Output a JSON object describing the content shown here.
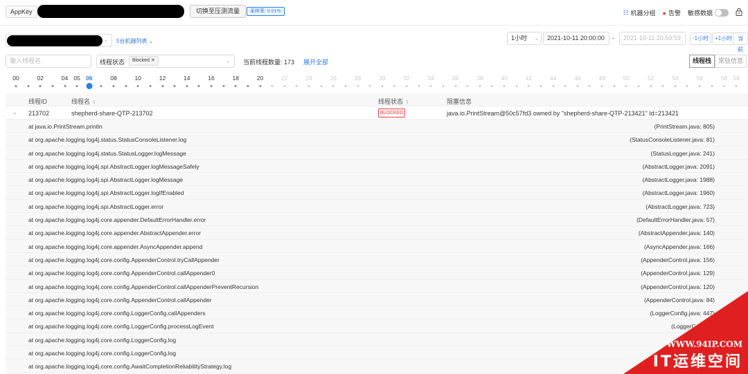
{
  "topbar": {
    "appkey_label": "AppKey",
    "switch_button": "切换至压测流量",
    "sample_rate": "采样率: 0.01%",
    "machine_group": "机器分组",
    "alarm": "告警",
    "sensitive_data": "敏感数据"
  },
  "filters": {
    "machine_list_link": "5台机器列表",
    "range": "1小时",
    "start_time": "2021-10-11 20:00:00",
    "time_separator": "-",
    "end_time": "2021-10-11 20:59:59",
    "step_minus_hour": "-1小时",
    "step_plus_hour": "+1小时",
    "current_btn": "当前"
  },
  "thread_filter": {
    "name_placeholder": "输入线程名",
    "state_label": "线程状态",
    "state_tag": "Blocked",
    "count_text": "当前线程数量: 173",
    "expand_all": "展开全部",
    "tab_stack": "线程栈",
    "tab_resident": "常驻信息"
  },
  "timeline": {
    "current_index": 4,
    "past_count": 11,
    "labels": [
      "00",
      "02",
      "04",
      "05",
      "06",
      "08",
      "10",
      "12",
      "14",
      "16",
      "18",
      "20",
      "22",
      "24",
      "26",
      "28",
      "30",
      "32",
      "34",
      "36",
      "38",
      "40",
      "42",
      "44",
      "46",
      "48",
      "50",
      "52",
      "54",
      "56",
      "58",
      "59"
    ]
  },
  "table": {
    "headers": {
      "thread_id": "线程ID",
      "thread_name": "线程名",
      "thread_state": "线程状态",
      "block_info": "阻塞信息"
    },
    "row": {
      "thread_id": "213702",
      "thread_name": "shepherd-share-QTP-213702",
      "thread_state": "BLOCKED",
      "block_info": "java.io.PrintStream@50c57fd3 owned by \"shepherd-share-QTP-213421\" Id=213421"
    },
    "stack": [
      {
        "method": "at java.io.PrintStream.println",
        "loc": "(PrintStream.java: 805)"
      },
      {
        "method": "at org.apache.logging.log4j.status.StatusConsoleListener.log",
        "loc": "(StatusConsoleListener.java: 81)"
      },
      {
        "method": "at org.apache.logging.log4j.status.StatusLogger.logMessage",
        "loc": "(StatusLogger.java: 241)"
      },
      {
        "method": "at org.apache.logging.log4j.spi.AbstractLogger.logMessageSafely",
        "loc": "(AbstractLogger.java: 2091)"
      },
      {
        "method": "at org.apache.logging.log4j.spi.AbstractLogger.logMessage",
        "loc": "(AbstractLogger.java: 1988)"
      },
      {
        "method": "at org.apache.logging.log4j.spi.AbstractLogger.logIfEnabled",
        "loc": "(AbstractLogger.java: 1960)"
      },
      {
        "method": "at org.apache.logging.log4j.spi.AbstractLogger.error",
        "loc": "(AbstractLogger.java: 723)"
      },
      {
        "method": "at org.apache.logging.log4j.core.appender.DefaultErrorHandler.error",
        "loc": "(DefaultErrorHandler.java: 57)"
      },
      {
        "method": "at org.apache.logging.log4j.core.appender.AbstractAppender.error",
        "loc": "(AbstractAppender.java: 140)"
      },
      {
        "method": "at org.apache.logging.log4j.core.appender.AsyncAppender.append",
        "loc": "(AsyncAppender.java: 166)"
      },
      {
        "method": "at org.apache.logging.log4j.core.config.AppenderControl.tryCallAppender",
        "loc": "(AppenderControl.java: 156)"
      },
      {
        "method": "at org.apache.logging.log4j.core.config.AppenderControl.callAppender0",
        "loc": "(AppenderControl.java: 129)"
      },
      {
        "method": "at org.apache.logging.log4j.core.config.AppenderControl.callAppenderPreventRecursion",
        "loc": "(AppenderControl.java: 120)"
      },
      {
        "method": "at org.apache.logging.log4j.core.config.AppenderControl.callAppender",
        "loc": "(AppenderControl.java: 84)"
      },
      {
        "method": "at org.apache.logging.log4j.core.config.LoggerConfig.callAppenders",
        "loc": "(LoggerConfig.java: 447)"
      },
      {
        "method": "at org.apache.logging.log4j.core.config.LoggerConfig.processLogEvent",
        "loc": "(LoggerConfig.ja"
      },
      {
        "method": "at org.apache.logging.log4j.core.config.LoggerConfig.log",
        "loc": "(Logg"
      },
      {
        "method": "at org.apache.logging.log4j.core.config.LoggerConfig.log",
        "loc": ""
      },
      {
        "method": "at org.apache.logging.log4j.core.config.AwaitCompletionReliabilityStrategy.log",
        "loc": ""
      }
    ]
  },
  "watermark": {
    "url": "WWW.94IP.COM",
    "name": "IT运维空间"
  },
  "colors": {
    "accent": "#2f7de1",
    "blocked": "#e54545",
    "corner": "#e02020"
  }
}
